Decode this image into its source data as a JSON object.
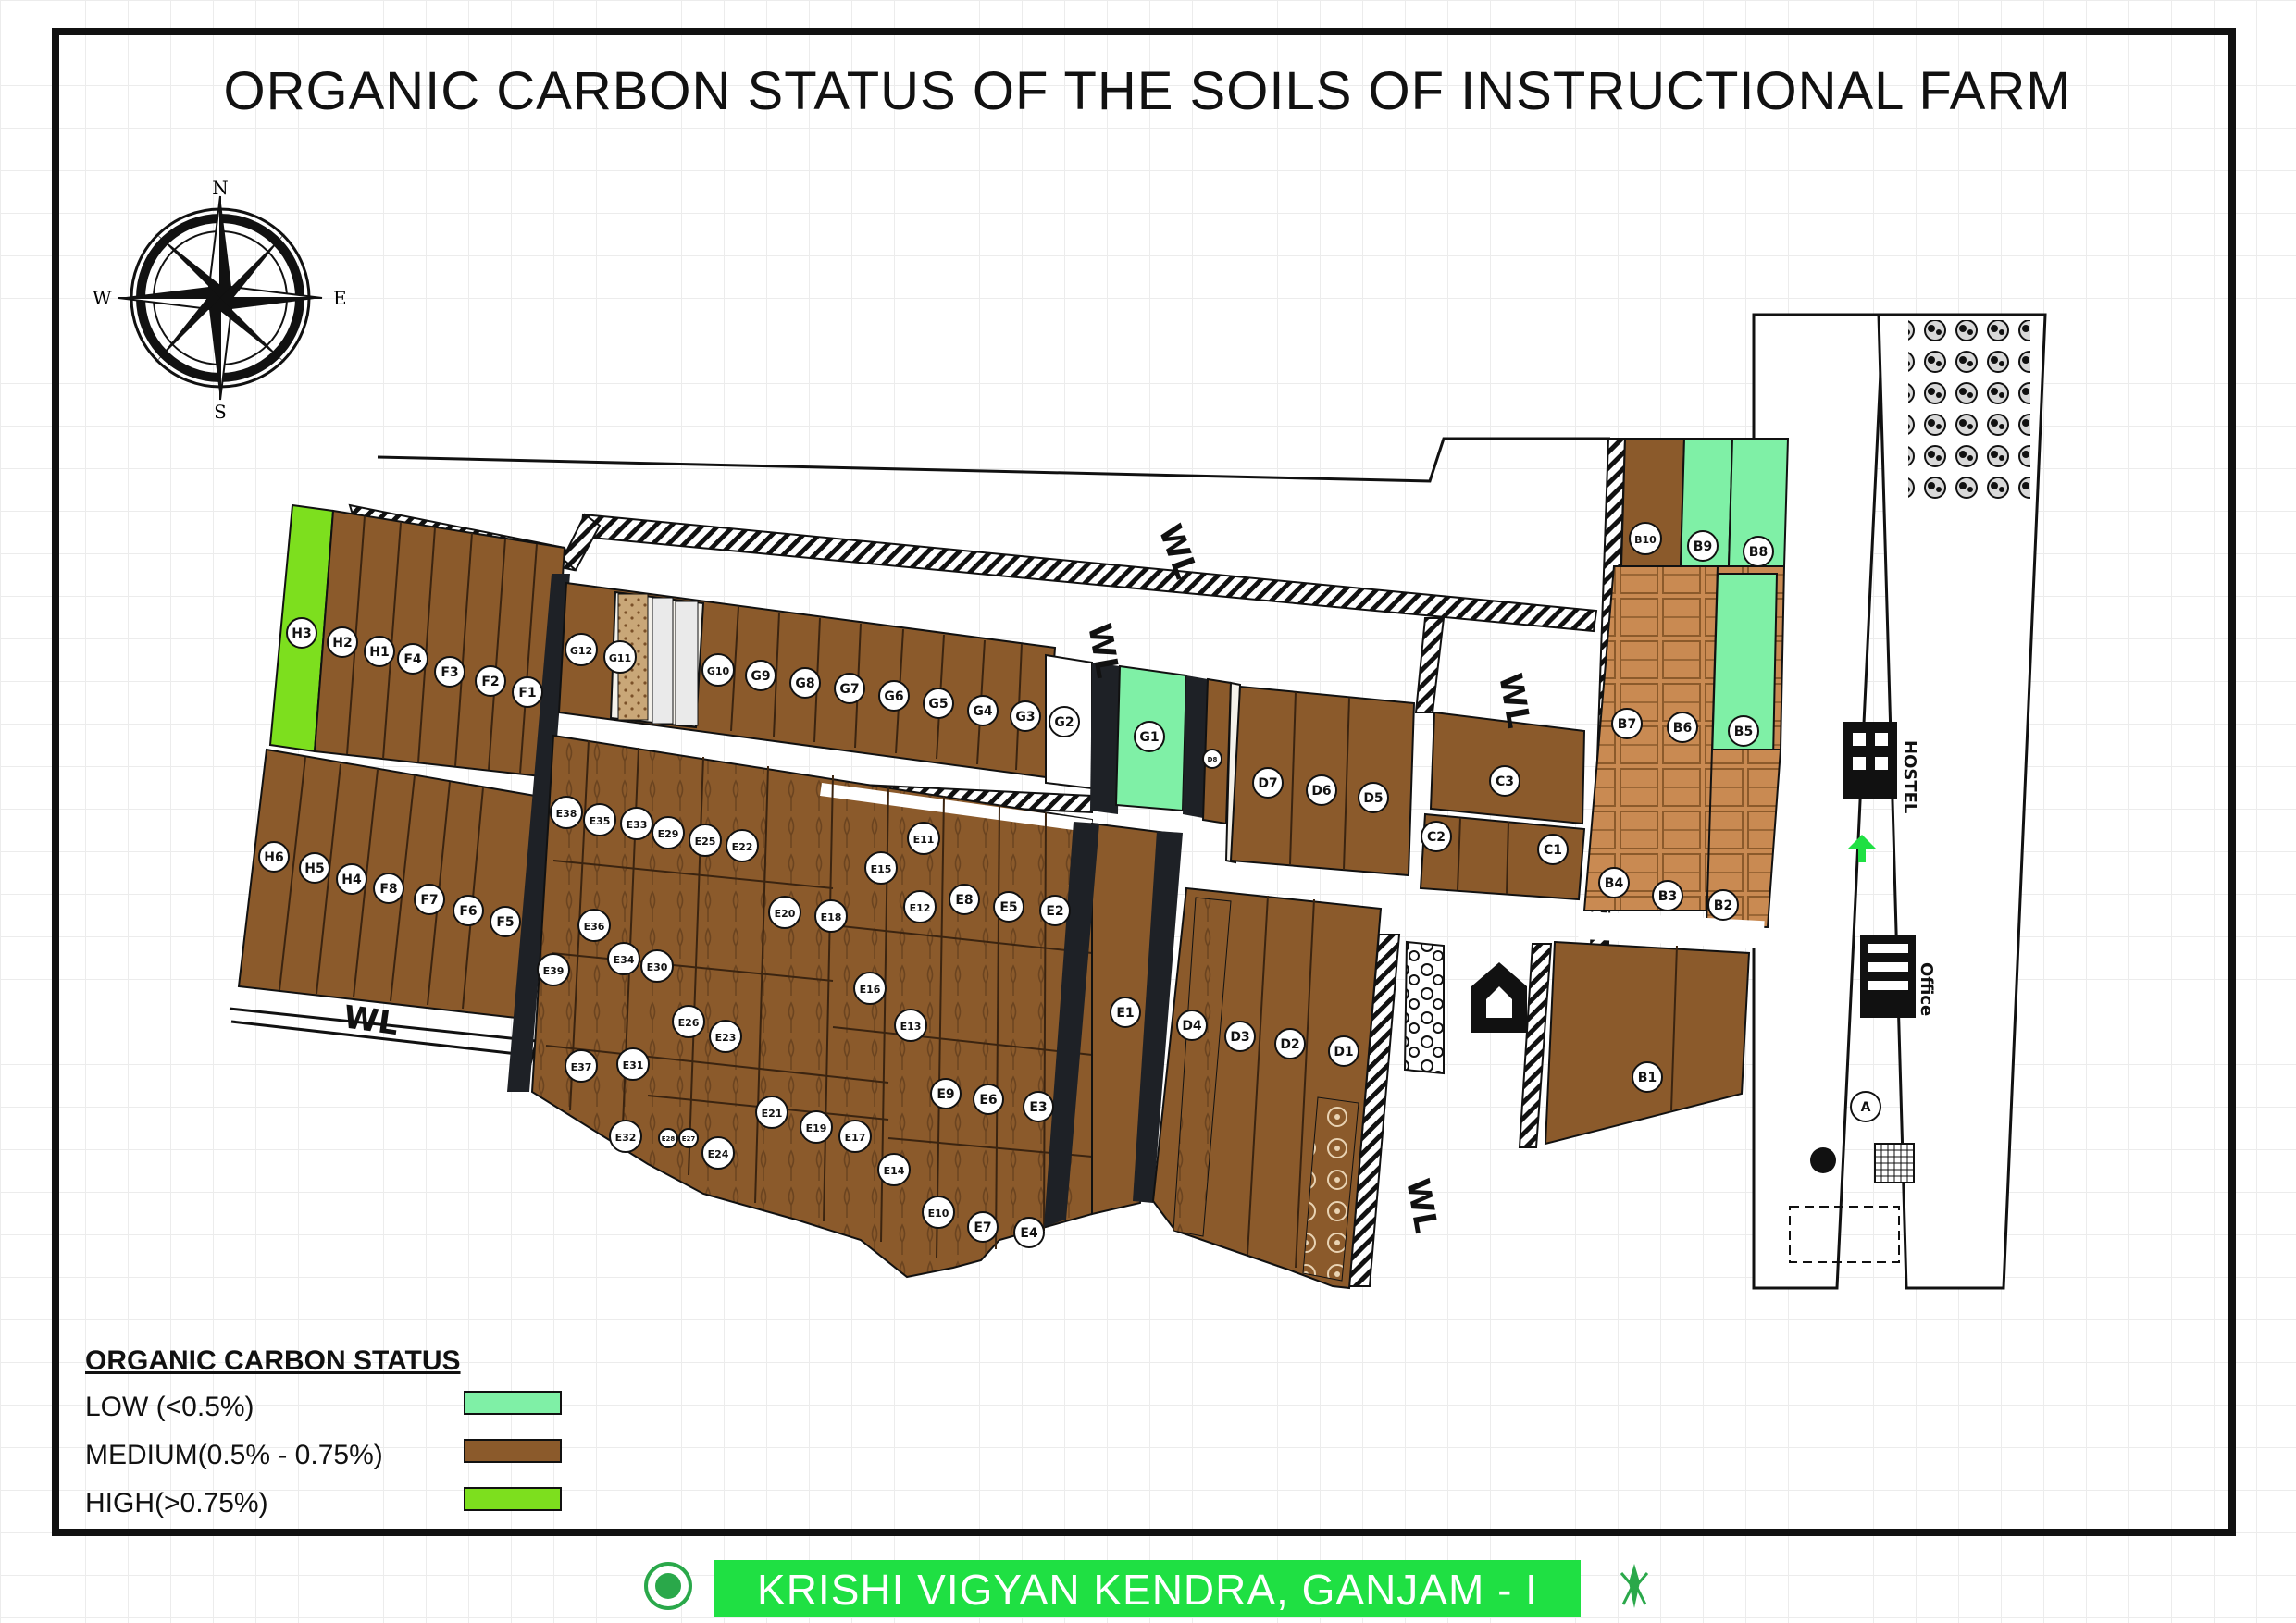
{
  "title": "ORGANIC CARBON STATUS OF THE SOILS OF INSTRUCTIONAL FARM",
  "compass": {
    "n": "N",
    "s": "S",
    "e": "E",
    "w": "W"
  },
  "colors": {
    "low": "#7ff0a6",
    "medium": "#8b5a2b",
    "high": "#7ddf1e",
    "road": "#1e2126",
    "orchard": "#c98a52",
    "grid_bg": "#ffffff",
    "footer_bg": "#1fe043"
  },
  "legend": {
    "heading": "ORGANIC CARBON STATUS",
    "items": [
      {
        "label": "LOW (<0.5%)",
        "status": "low"
      },
      {
        "label": "MEDIUM(0.5% - 0.75%)",
        "status": "medium"
      },
      {
        "label": "HIGH(>0.75%)",
        "status": "high"
      }
    ]
  },
  "waterway_label": "WL",
  "footer": {
    "text": "KRISHI VIGYAN KENDRA, GANJAM - I"
  },
  "building_labels": {
    "hostel": "HOSTEL",
    "office": "Office"
  },
  "plots": {
    "H": [
      "H3",
      "H2",
      "H1",
      "H6",
      "H5",
      "H4"
    ],
    "F": [
      "F4",
      "F3",
      "F2",
      "F1",
      "F8",
      "F7",
      "F6",
      "F5"
    ],
    "G": [
      "G12",
      "G11",
      "G10",
      "G9",
      "G8",
      "G7",
      "G6",
      "G5",
      "G4",
      "G3",
      "G2",
      "G1"
    ],
    "D": [
      "D7",
      "D6",
      "D5",
      "D4",
      "D3",
      "D2",
      "D1",
      "D8"
    ],
    "C": [
      "C3",
      "C2",
      "C1"
    ],
    "B": [
      "B10",
      "B9",
      "B8",
      "B7",
      "B6",
      "B5",
      "B4",
      "B3",
      "B2",
      "B1"
    ],
    "E": [
      "E38",
      "E35",
      "E33",
      "E29",
      "E25",
      "E22",
      "E11",
      "E15",
      "E36",
      "E20",
      "E18",
      "E12",
      "E8",
      "E5",
      "E2",
      "E34",
      "E30",
      "E39",
      "E16",
      "E26",
      "E23",
      "E13",
      "E1",
      "E37",
      "E31",
      "E9",
      "E6",
      "E3",
      "E21",
      "E19",
      "E17",
      "E32",
      "E28",
      "E27",
      "E24",
      "E14",
      "E10",
      "E7",
      "E4"
    ],
    "misc": [
      "A"
    ]
  },
  "plot_status": {
    "H3": "high",
    "G1": "low",
    "B9": "low",
    "B8": "low",
    "B5": "low"
  }
}
